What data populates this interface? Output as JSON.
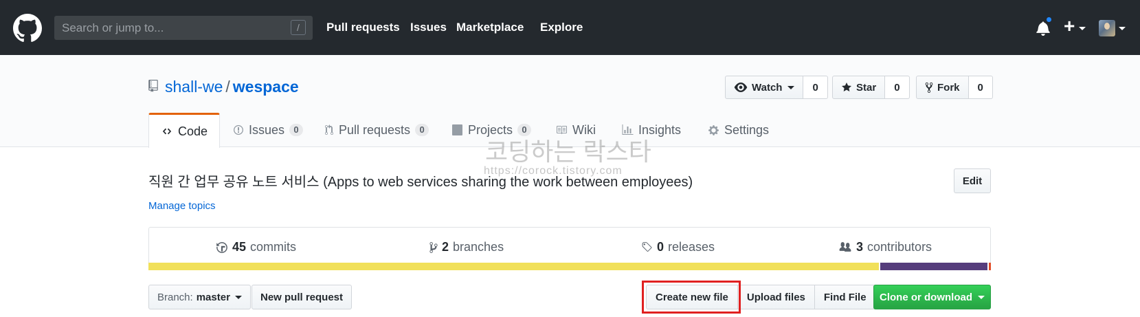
{
  "header": {
    "search_placeholder": "Search or jump to...",
    "search_shortcut": "/",
    "nav": [
      "Pull requests",
      "Issues",
      "Marketplace",
      "Explore"
    ],
    "notification_dot_color": "#2188ff",
    "plus_label": "+"
  },
  "repo": {
    "owner": "shall-we",
    "separator": "/",
    "name": "wespace",
    "watch_label": "Watch",
    "watch_count": "0",
    "star_label": "Star",
    "star_count": "0",
    "fork_label": "Fork",
    "fork_count": "0"
  },
  "tabs": [
    {
      "label": "Code"
    },
    {
      "label": "Issues",
      "count": "0"
    },
    {
      "label": "Pull requests",
      "count": "0"
    },
    {
      "label": "Projects",
      "count": "0"
    },
    {
      "label": "Wiki"
    },
    {
      "label": "Insights"
    },
    {
      "label": "Settings"
    }
  ],
  "description": {
    "text": "직원 간 업무 공유 노트 서비스 (Apps to web services sharing the work between employees)",
    "edit_label": "Edit",
    "manage_topics": "Manage topics"
  },
  "summary": {
    "commits_count": "45",
    "commits_label": "commits",
    "branches_count": "2",
    "branches_label": "branches",
    "releases_count": "0",
    "releases_label": "releases",
    "contributors_count": "3",
    "contributors_label": "contributors"
  },
  "language_bar": [
    {
      "color": "#f1e05a",
      "fraction": 0.867
    },
    {
      "color": "#563d7c",
      "fraction": 0.129
    },
    {
      "color": "#e34c26",
      "fraction": 0.004
    }
  ],
  "file_nav": {
    "branch_prefix": "Branch:",
    "branch_name": "master",
    "new_pull_request": "New pull request",
    "create_new_file": "Create new file",
    "upload_files": "Upload files",
    "find_file": "Find File",
    "clone_or_download": "Clone or download",
    "highlight_color": "#e02020"
  },
  "watermark": {
    "line1": "코딩하는 락스타",
    "line2": "https://corock.tistory.com"
  }
}
